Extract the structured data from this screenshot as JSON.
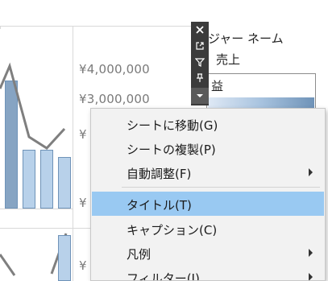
{
  "axis": {
    "label_4m": "¥4,000,000",
    "label_3m": "¥3,000,000",
    "label_y1": "¥",
    "label_y2": "¥",
    "label_y3": "¥"
  },
  "side_panel": {
    "row1": "ジャー ネーム",
    "row2": "売上",
    "row3": "益"
  },
  "toolbar": {
    "icons": [
      "close-icon",
      "popout-icon",
      "filter-icon",
      "pin-icon",
      "dropdown-arrow-icon"
    ]
  },
  "menu": {
    "items": [
      {
        "label": "シートに移動(G)",
        "submenu": false
      },
      {
        "label": "シートの複製(P)",
        "submenu": false
      },
      {
        "label": "自動調整(F)",
        "submenu": true
      },
      {
        "label": "タイトル(T)",
        "submenu": false,
        "highlighted": true
      },
      {
        "label": "キャプション(C)",
        "submenu": false
      },
      {
        "label": "凡例",
        "submenu": true
      },
      {
        "label": "フィルター(I)",
        "submenu": true
      }
    ]
  },
  "colors": {
    "menu_highlight": "#99c9f2",
    "bar_dark": "#86a4c3",
    "bar_light": "#b8d1ea",
    "toolbar_bg": "#3b3b3b"
  }
}
